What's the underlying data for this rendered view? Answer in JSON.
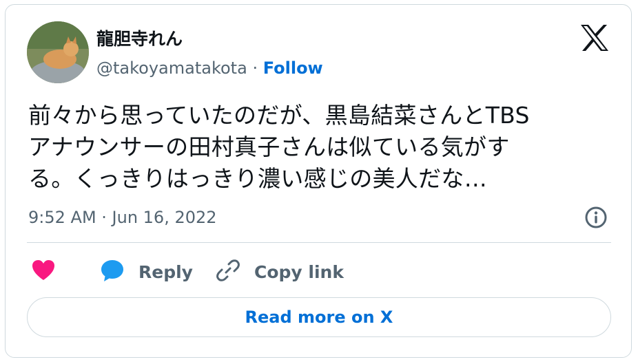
{
  "author": {
    "display_name": "龍胆寺れん",
    "handle": "@takoyamatakota",
    "separator": " · ",
    "follow_label": "Follow"
  },
  "tweet": {
    "lines": [
      "前々から思っていたのだが、黒島結菜さんとTBS",
      "アナウンサーの田村真子さんは似ている気がす",
      "る。くっきりはっきり濃い感じの美人だな…"
    ],
    "timestamp": "9:52 AM · Jun 16, 2022"
  },
  "actions": {
    "reply_label": "Reply",
    "copy_link_label": "Copy link"
  },
  "read_more_label": "Read more on X",
  "colors": {
    "accent": "#006fd6",
    "heart": "#f91880",
    "reply_bubble": "#1d9bf0",
    "muted_text": "#536471",
    "border": "#cfd9de"
  },
  "icons": [
    "x-logo-icon",
    "info-icon",
    "heart-icon",
    "reply-icon",
    "link-icon"
  ]
}
